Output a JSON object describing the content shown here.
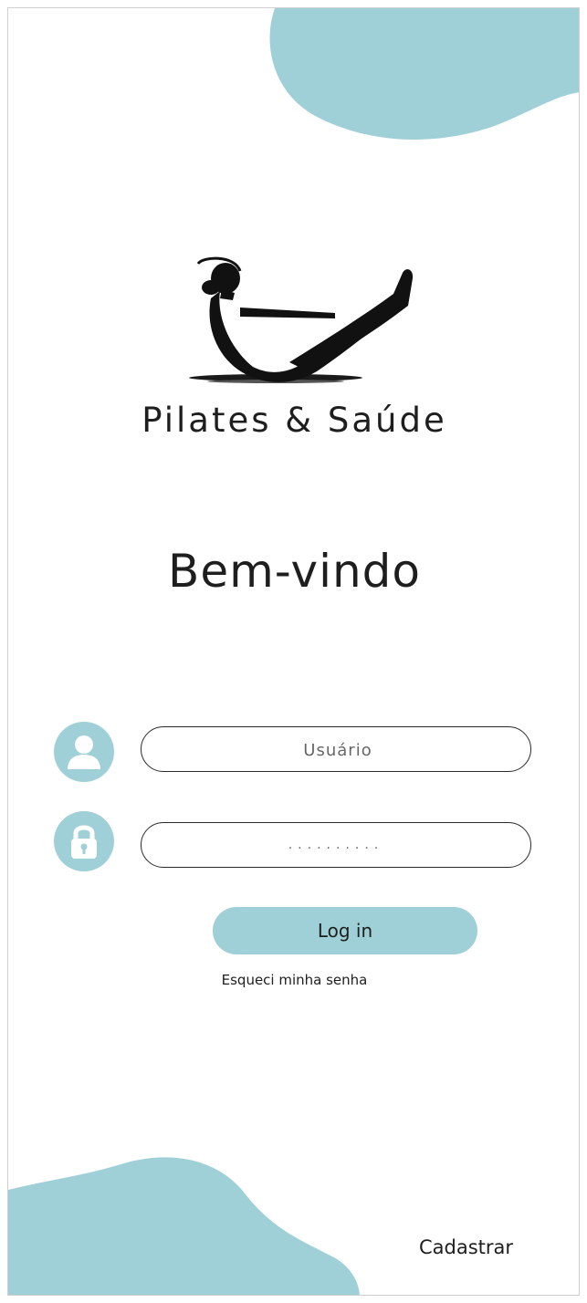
{
  "colors": {
    "accent": "#9fd0d7",
    "text": "#1e1e1e",
    "background": "#ffffff"
  },
  "brand": {
    "name": "Pilates & Saúde",
    "logo_icon": "pilates-pose-icon"
  },
  "welcome": "Bem-vindo",
  "username": {
    "icon": "user-icon",
    "placeholder": "Usuário",
    "value": ""
  },
  "password": {
    "icon": "lock-icon",
    "masked_value": ".........."
  },
  "login_button": "Log in",
  "forgot_password": "Esqueci minha senha",
  "register_link": "Cadastrar"
}
